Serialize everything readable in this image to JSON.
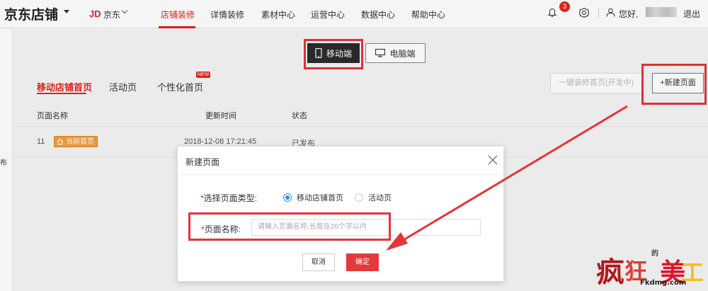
{
  "header": {
    "brand": "京东店铺",
    "jd_logo": "JD",
    "jd_name": "京东",
    "nav": [
      "店铺装修",
      "详情装修",
      "素材中心",
      "运营中心",
      "数据中心",
      "帮助中心"
    ],
    "active_nav": "店铺装修",
    "notification_count": "3",
    "greeting": "您好,",
    "logout": "退出"
  },
  "left_strip_text": "布",
  "device_toggle": {
    "mobile": "移动端",
    "pc": "电脑端"
  },
  "tabs": {
    "items": [
      "移动店铺首页",
      "活动页",
      "个性化首页"
    ],
    "new_badge": "NEW"
  },
  "actions": {
    "one_click": "一键装修首页(开发中)",
    "new_page": "+新建页面"
  },
  "table": {
    "headers": [
      "页面名称",
      "更新时间",
      "状态"
    ],
    "rows": [
      {
        "name": "11",
        "tag": "当前首页",
        "time": "2018-12-08 17:21:45",
        "status": "已发布"
      }
    ]
  },
  "modal": {
    "title": "新建页面",
    "type_label": "选择页面类型:",
    "type_options": [
      "移动店铺首页",
      "活动页"
    ],
    "selected_type": "移动店铺首页",
    "name_label": "页面名称:",
    "name_placeholder": "请输入页面名称,长度在20个字以内",
    "required_mark": "*",
    "cancel": "取消",
    "confirm": "确定"
  },
  "watermark": {
    "chars": [
      "疯",
      "狂",
      "的",
      "美",
      "工"
    ],
    "url": "Fkdmg.com"
  },
  "colors": {
    "accent": "#e1251b",
    "highlight": "#e5343a",
    "radio": "#2d8cf0"
  }
}
